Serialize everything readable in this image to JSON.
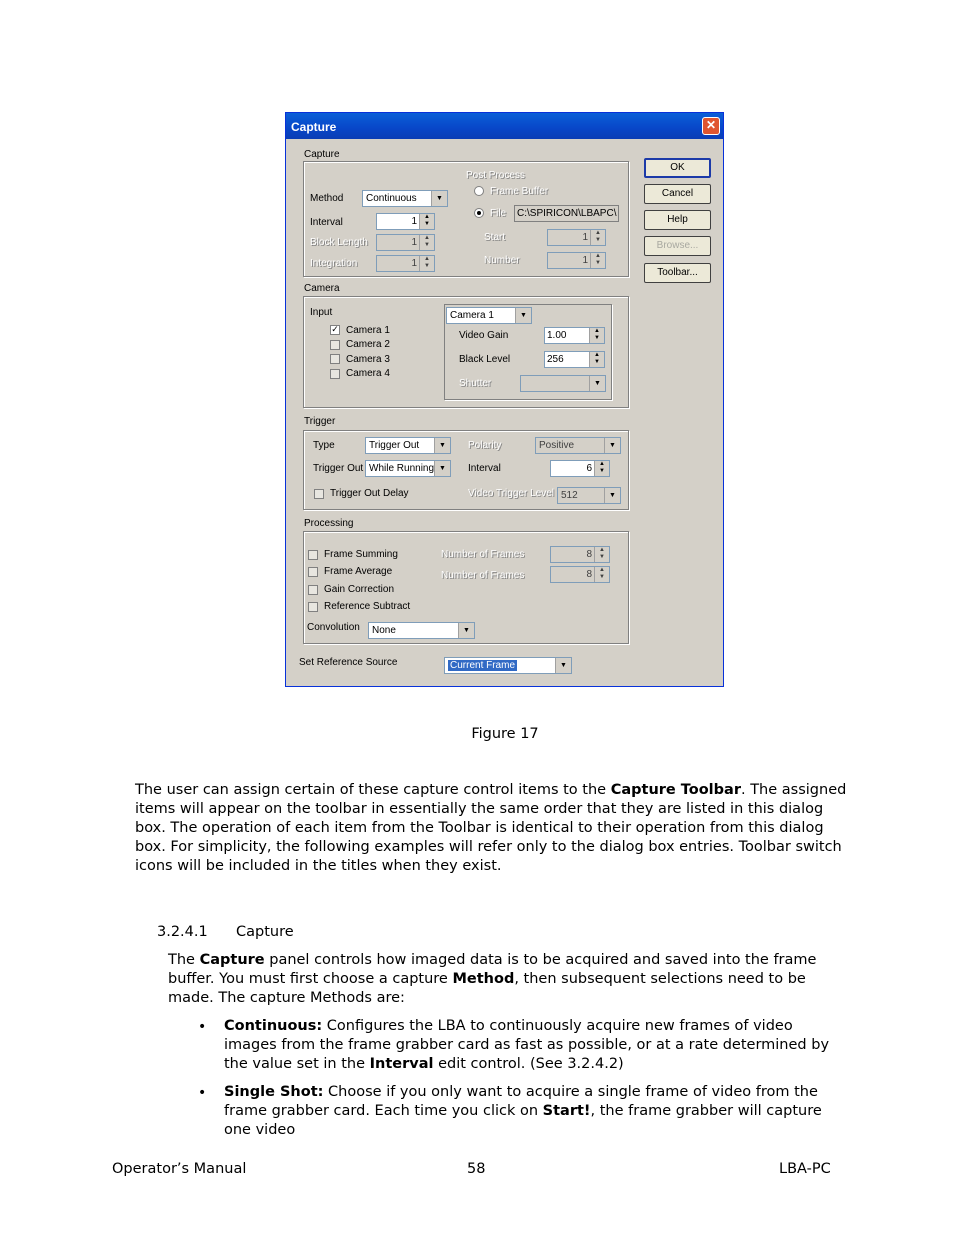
{
  "dialog": {
    "title": "Capture",
    "buttons": {
      "ok": "OK",
      "cancel": "Cancel",
      "help": "Help",
      "browse": "Browse...",
      "toolbar": "Toolbar..."
    },
    "capture": {
      "label": "Capture",
      "method_label": "Method",
      "method_value": "Continuous",
      "interval_label": "Interval",
      "interval_value": "1",
      "block_length_label": "Block Length",
      "block_length_value": "1",
      "integration_label": "Integration",
      "integration_value": "1",
      "post_process_label": "Post Process",
      "frame_buffer_label": "Frame Buffer",
      "file_label": "File",
      "file_value": "C:\\SPIRICON\\LBAPC\\",
      "start_label": "Start",
      "start_value": "1",
      "number_label": "Number",
      "number_value": "1"
    },
    "camera": {
      "label": "Camera",
      "input_label": "Input",
      "cameras": [
        "Camera 1",
        "Camera 2",
        "Camera 3",
        "Camera 4"
      ],
      "camera_select": "Camera 1",
      "video_gain_label": "Video Gain",
      "video_gain_value": "1.00",
      "black_level_label": "Black Level",
      "black_level_value": "256",
      "shutter_label": "Shutter"
    },
    "trigger": {
      "label": "Trigger",
      "type_label": "Type",
      "type_value": "Trigger Out",
      "trigger_out_label": "Trigger Out",
      "trigger_out_value": "While Running",
      "delay_label": "Trigger Out Delay",
      "polarity_label": "Polarity",
      "polarity_value": "Positive",
      "interval_label": "Interval",
      "interval_value": "6",
      "video_trigger_label": "Video Trigger Level",
      "video_trigger_value": "512"
    },
    "processing": {
      "label": "Processing",
      "frame_summing": "Frame Summing",
      "frame_average": "Frame Average",
      "gain_correction": "Gain Correction",
      "reference_subtract": "Reference Subtract",
      "num_frames_label": "Number of Frames",
      "num_frames_1": "8",
      "num_frames_2": "8",
      "convolution_label": "Convolution",
      "convolution_value": "None"
    },
    "ref_source_label": "Set Reference Source",
    "ref_source_value": "Current Frame"
  },
  "document": {
    "caption": "Figure 17",
    "para1": [
      {
        "t": "The user can assign certain of these capture control items to the "
      },
      {
        "t": "Capture Toolbar",
        "b": true
      },
      {
        "t": ".  The assigned items will appear on the toolbar in essentially the same order that they are listed in this dialog box.  The operation of each item from the Toolbar is identical to their operation from this dialog box.  For simplicity, the following examples will refer only to the dialog box entries.  Toolbar switch icons will be included in the titles when they exist."
      }
    ],
    "section_number": "3.2.4.1",
    "section_title": "Capture",
    "para2": [
      {
        "t": "The "
      },
      {
        "t": "Capture",
        "b": true
      },
      {
        "t": " panel controls how imaged data is to be acquired and saved into the frame buffer.  You must first choose a capture "
      },
      {
        "t": "Method",
        "b": true
      },
      {
        "t": ", then subsequent selections need to be made.  The capture Methods are:"
      }
    ],
    "bullet1": [
      {
        "t": "Continuous:",
        "b": true
      },
      {
        "t": "   Configures the LBA to continuously acquire new frames of video images from the frame grabber card as fast as possible, or at a rate determined by the value set in the "
      },
      {
        "t": "Interval",
        "b": true
      },
      {
        "t": " edit control. (See 3.2.4.2)"
      }
    ],
    "bullet2": [
      {
        "t": "Single Shot:",
        "b": true
      },
      {
        "t": "  Choose if you only want to acquire a single frame of video from the frame grabber card.  Each time you click on "
      },
      {
        "t": "Start!",
        "b": true
      },
      {
        "t": ", the frame grabber will capture one video"
      }
    ],
    "footer_left": "Operator’s Manual",
    "footer_center": "58",
    "footer_right": "LBA-PC"
  }
}
